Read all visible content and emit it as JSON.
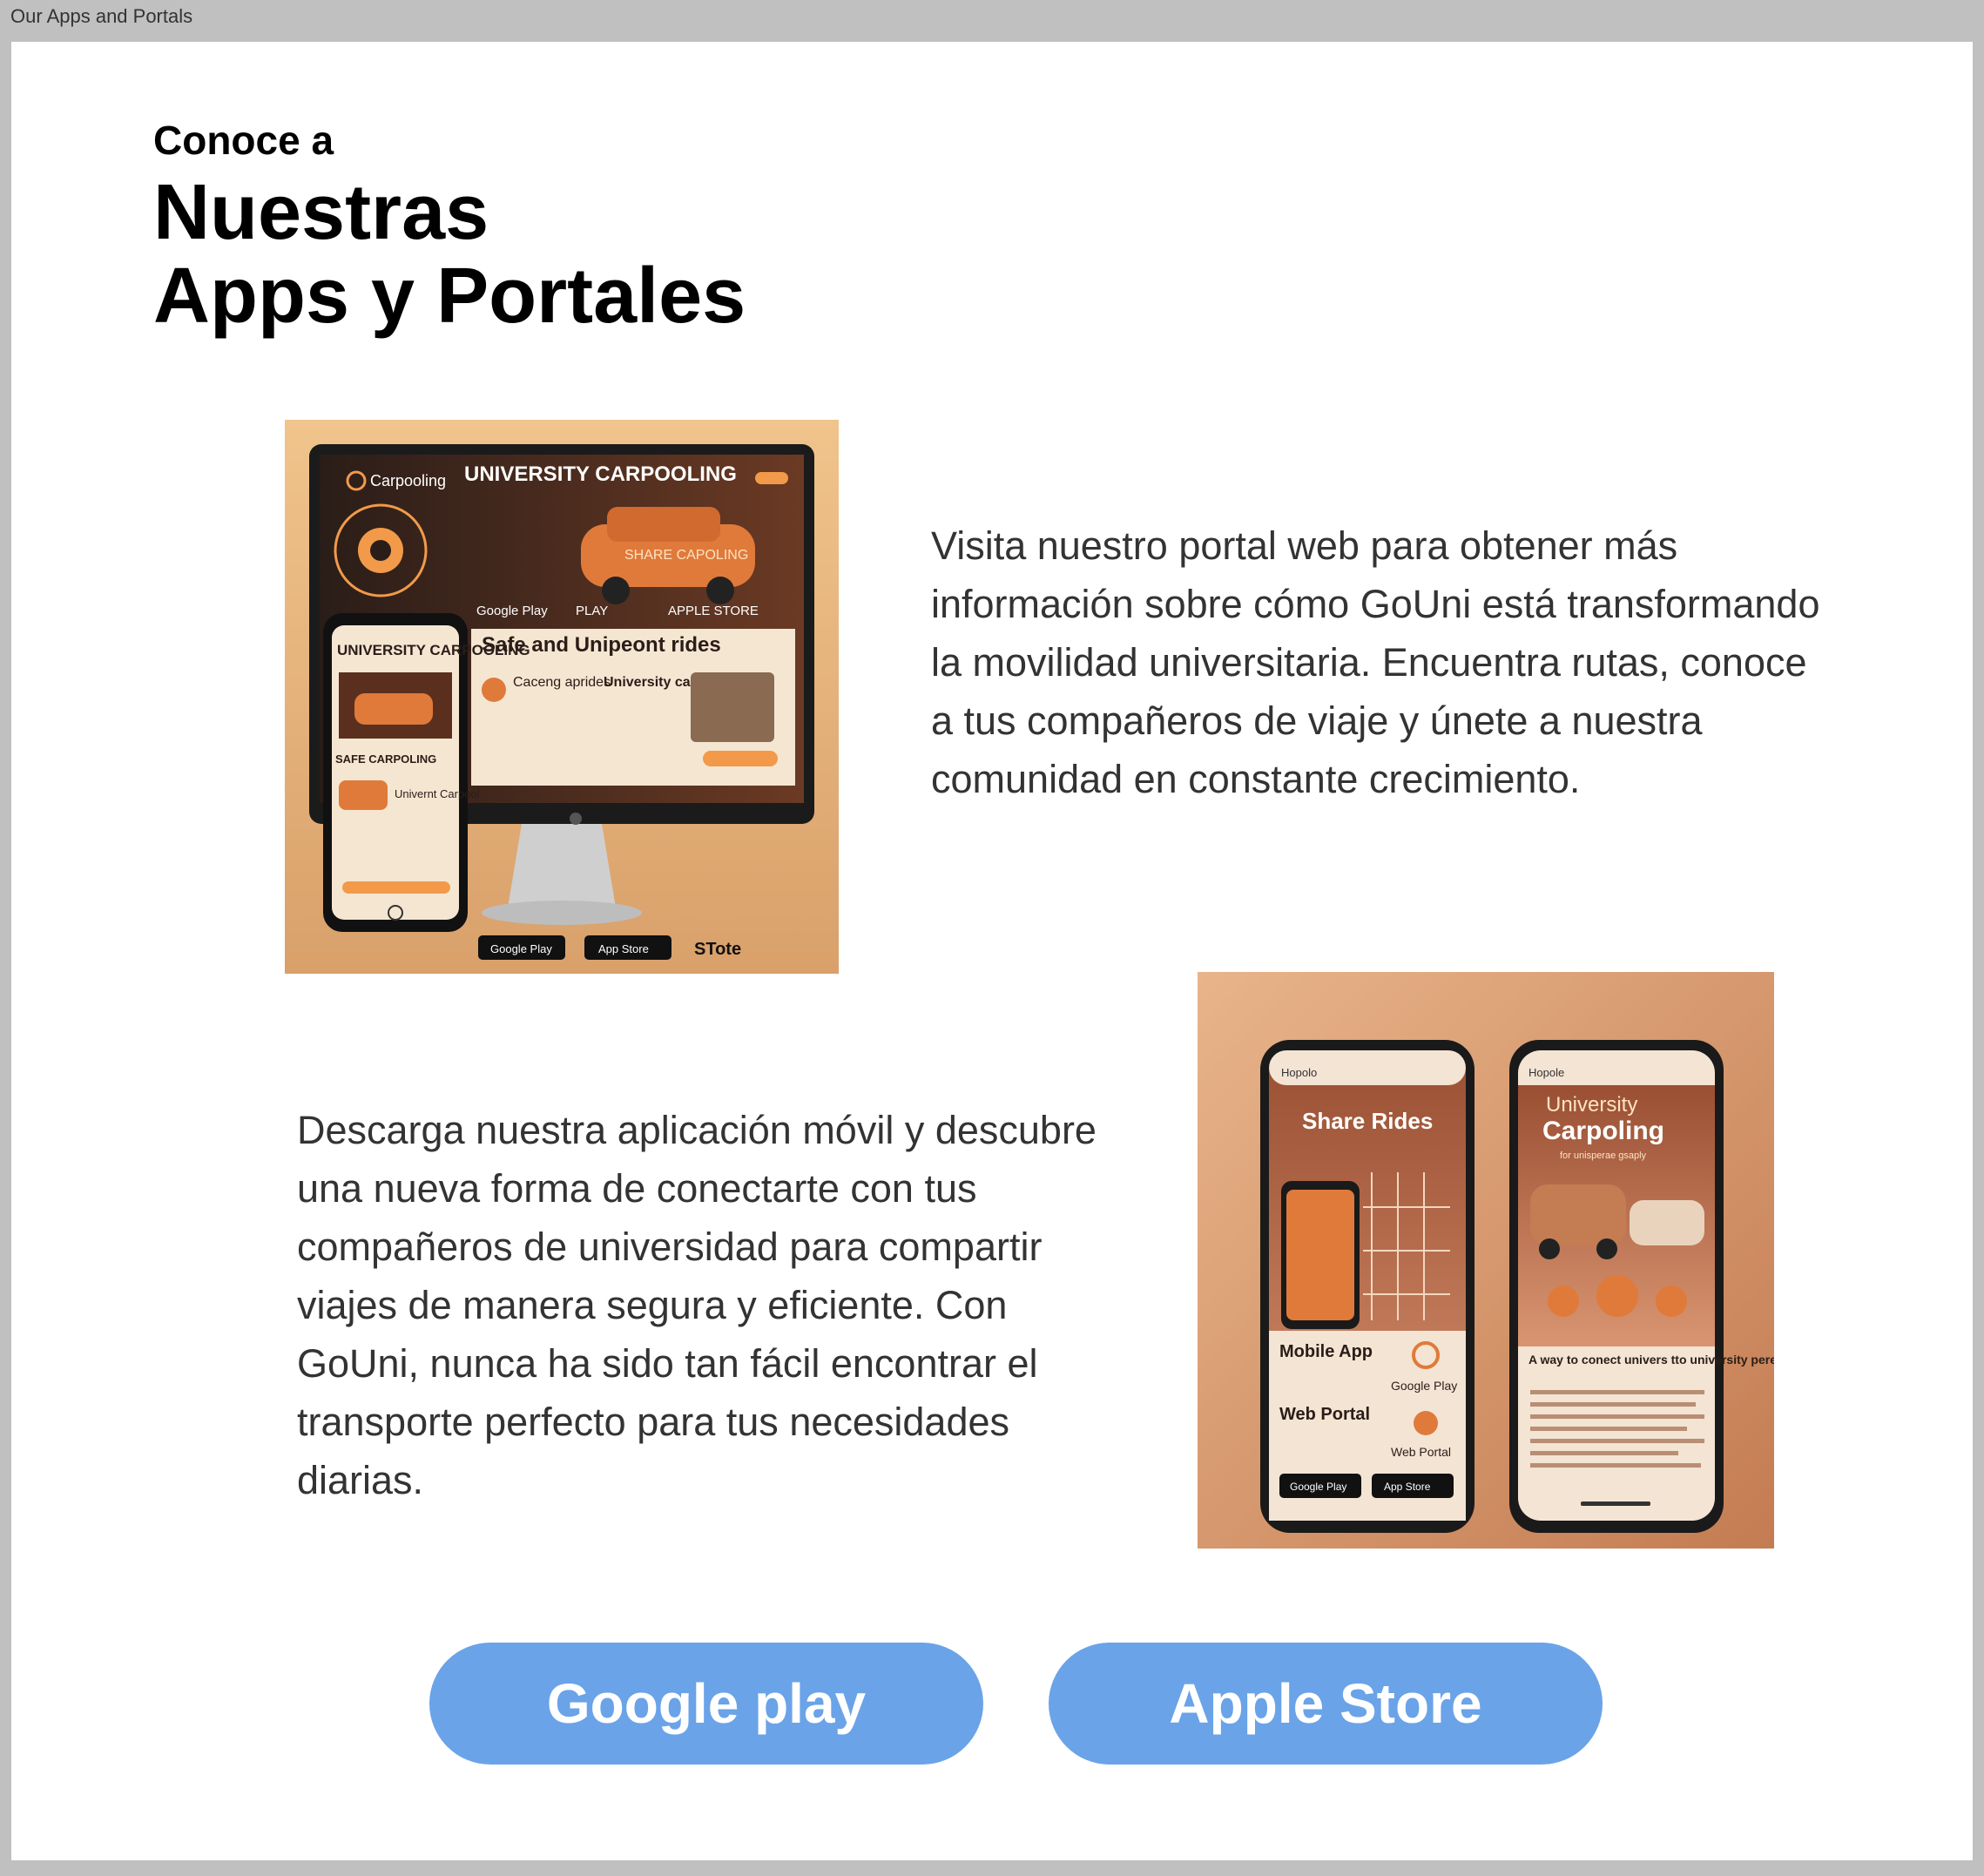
{
  "window": {
    "title": "Our Apps and Portals"
  },
  "header": {
    "eyebrow": "Conoce a",
    "title_line1": "Nuestras",
    "title_line2": "Apps y Portales"
  },
  "portal_section": {
    "description": "Visita nuestro portal web para obtener más información sobre cómo GoUni está transformando la movilidad universitaria. Encuentra rutas, conoce a tus compañeros de viaje y únete a nuestra comunidad en constante crecimiento.",
    "image": {
      "brand": "Carpooling",
      "headline": "UNIVERSITY CARPOOLING",
      "badge": "SHARE CAPOLING",
      "store_row": [
        "Google Play",
        "PLAY",
        "APPLE STORE"
      ],
      "banner": "Safe and Unipeont rides",
      "feature1": "Caceng aprides",
      "feature2": "University carpoling",
      "phone_headline": "UNIVERSITY CARPOOLING",
      "phone_badge": "SAFE CARPOLING",
      "phone_feature": "Univernt Carpool",
      "bottom_badges": [
        "Google Play",
        "App Store",
        "STote"
      ]
    }
  },
  "app_section": {
    "description": "Descarga nuestra aplicación móvil y descubre una nueva forma de conectarte con tus compañeros de universidad para compartir viajes de manera segura y eficiente. Con GoUni, nunca ha sido tan fácil encontrar el transporte perfecto para tus necesidades diarias.",
    "image": {
      "left_phone": {
        "brand": "Hopolo",
        "headline": "Share Rides",
        "item1_title": "Mobile App",
        "item1_store": "Google Play",
        "item2_title": "Web Portal",
        "item2_store": "Web Portal",
        "badges": [
          "Google Play",
          "App Store"
        ]
      },
      "right_phone": {
        "brand": "Hopole",
        "headline1": "University",
        "headline2": "Carpoling",
        "tagline": "for unisperae gsaply",
        "caption": "A way to conect univers tto university peres to efficiently and safely."
      }
    }
  },
  "buttons": {
    "google_label": "Google play",
    "apple_label": "Apple Store"
  },
  "colors": {
    "button_bg": "#6aa3e8",
    "chrome_bg": "#c0c0c0",
    "image_warm": "#e9b27a",
    "accent_orange": "#d8743a"
  }
}
